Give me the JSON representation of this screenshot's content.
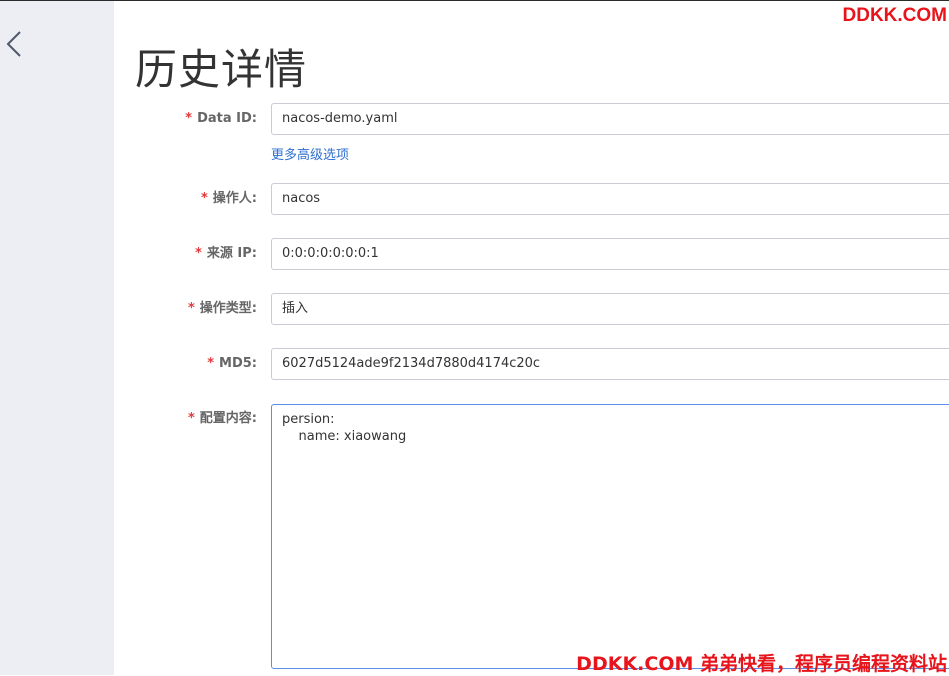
{
  "page": {
    "title": "历史详情"
  },
  "icons": {
    "back": "chevron-left-icon"
  },
  "colors": {
    "sidebar_bg": "#eceef3",
    "required_mark": "#e4393c",
    "link": "#2f6fd1",
    "focus_border": "#5b8fe6",
    "watermark": "#e8141b"
  },
  "form": {
    "required_mark": "*",
    "data_id": {
      "label": "Data ID:",
      "value": "nacos-demo.yaml"
    },
    "advanced_link": "更多高级选项",
    "operator": {
      "label": "操作人:",
      "value": "nacos"
    },
    "source_ip": {
      "label": "来源 IP:",
      "value": "0:0:0:0:0:0:0:1"
    },
    "op_type": {
      "label": "操作类型:",
      "value": "插入"
    },
    "md5": {
      "label": "MD5:",
      "value": "6027d5124ade9f2134d7880d4174c20c"
    },
    "content": {
      "label": "配置内容:",
      "value": "persion:\n    name: xiaowang"
    }
  },
  "watermark": {
    "top": "DDKK.COM",
    "bottom": "DDKK.COM 弟弟快看，程序员编程资料站"
  }
}
